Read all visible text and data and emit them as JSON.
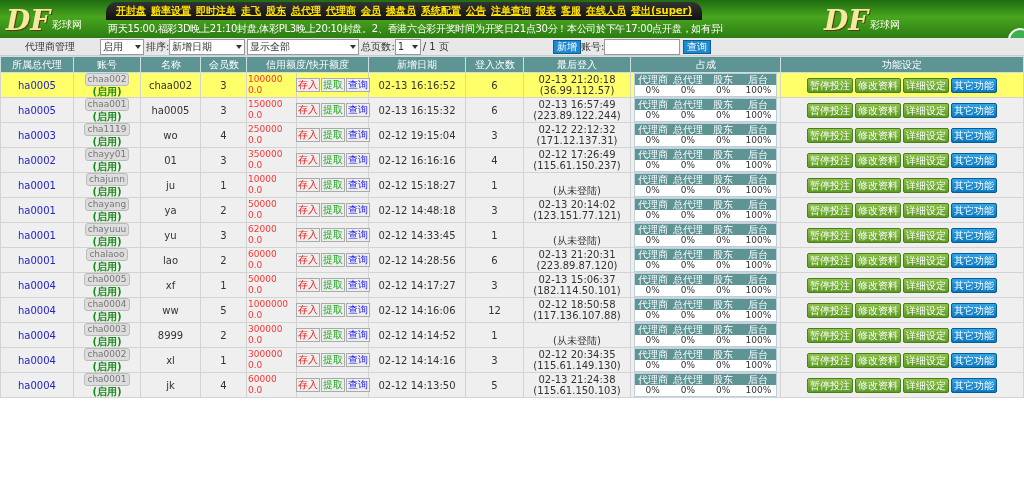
{
  "header": {
    "logos": [
      {
        "mark": "DF",
        "sub": "彩球网"
      },
      {
        "mark": "DF",
        "sub": "彩球网"
      }
    ],
    "menu": [
      "开封盘",
      "赔率设置",
      "即时注单",
      "走飞",
      "股东",
      "总代理",
      "代理商",
      "会员",
      "操盘员",
      "系统配置",
      "公告",
      "注单查询",
      "报表",
      "客服",
      "在线人员",
      "登出(super)"
    ],
    "marquee": "两天15:00,福彩3D晚上21:10封盘,体彩PL3晚上20:10封盘。2、香港六合彩开奖时间为开奖日21点30分！本公司於下午17:00点开盘，如有异i"
  },
  "toolbar": {
    "title": "代理商管理",
    "status_select": "启用",
    "sort_label": "排序:",
    "sort_select": "新增日期",
    "filter_select": "显示全部",
    "pages_label": "总页数:",
    "page_select": "1",
    "pages_total": "/ 1 页",
    "add_button": "新增",
    "account_label": "账号:",
    "search_button": "查询"
  },
  "table": {
    "columns": [
      "所属总代理",
      "账号",
      "名称",
      "会员数",
      "信用额度/快开额度",
      "新增日期",
      "登入次数",
      "最后登入",
      "占成",
      "功能设定"
    ],
    "rows": [
      {
        "selected": true,
        "agent": "ha0005",
        "account": "chaa002",
        "status": "(启用)",
        "name": "chaa002",
        "members": "3",
        "credit": "100000",
        "quick": "0.0",
        "credit_buttons": [
          {
            "label": "存入",
            "kind": "deposit"
          },
          {
            "label": "提取",
            "kind": "withdraw"
          },
          {
            "label": "查询",
            "kind": "query"
          }
        ],
        "added": "02-13 16:16:52",
        "logins": "6",
        "last_login": [
          "02-13 21:20:18",
          "(36.99.112.57)"
        ],
        "shares": [
          {
            "label": "代理商",
            "value": "0%"
          },
          {
            "label": "总代理",
            "value": "0%"
          },
          {
            "label": "股东",
            "value": "0%"
          },
          {
            "label": "后台",
            "value": "100%"
          }
        ],
        "actions": [
          {
            "label": "暂停投注",
            "kind": "green"
          },
          {
            "label": "修改资料",
            "kind": "green"
          },
          {
            "label": "详细设定",
            "kind": "green"
          },
          {
            "label": "其它功能",
            "kind": "blue"
          }
        ]
      },
      {
        "selected": false,
        "agent": "ha0005",
        "account": "chaa001",
        "status": "(启用)",
        "name": "ha0005",
        "members": "3",
        "credit": "150000",
        "quick": "0.0",
        "credit_buttons": [
          {
            "label": "存入",
            "kind": "deposit"
          },
          {
            "label": "提取",
            "kind": "withdraw"
          },
          {
            "label": "查询",
            "kind": "query"
          }
        ],
        "added": "02-13 16:15:32",
        "logins": "6",
        "last_login": [
          "02-13 16:57:49",
          "(223.89.122.244)"
        ],
        "shares": [
          {
            "label": "代理商",
            "value": "0%"
          },
          {
            "label": "总代理",
            "value": "0%"
          },
          {
            "label": "股东",
            "value": "0%"
          },
          {
            "label": "后台",
            "value": "100%"
          }
        ],
        "actions": [
          {
            "label": "暂停投注",
            "kind": "green"
          },
          {
            "label": "修改资料",
            "kind": "green"
          },
          {
            "label": "详细设定",
            "kind": "green"
          },
          {
            "label": "其它功能",
            "kind": "blue"
          }
        ]
      },
      {
        "selected": false,
        "agent": "ha0003",
        "account": "cha1119",
        "status": "(启用)",
        "name": "wo",
        "members": "4",
        "credit": "250000",
        "quick": "0.0",
        "credit_buttons": [
          {
            "label": "存入",
            "kind": "deposit"
          },
          {
            "label": "提取",
            "kind": "withdraw"
          },
          {
            "label": "查询",
            "kind": "query"
          }
        ],
        "added": "02-12 19:15:04",
        "logins": "3",
        "last_login": [
          "02-12 22:12:32",
          "(171.12.137.31)"
        ],
        "shares": [
          {
            "label": "代理商",
            "value": "0%"
          },
          {
            "label": "总代理",
            "value": "0%"
          },
          {
            "label": "股东",
            "value": "0%"
          },
          {
            "label": "后台",
            "value": "100%"
          }
        ],
        "actions": [
          {
            "label": "暂停投注",
            "kind": "green"
          },
          {
            "label": "修改资料",
            "kind": "green"
          },
          {
            "label": "详细设定",
            "kind": "green"
          },
          {
            "label": "其它功能",
            "kind": "blue"
          }
        ]
      },
      {
        "selected": false,
        "agent": "ha0002",
        "account": "chayy01",
        "status": "(启用)",
        "name": "01",
        "members": "3",
        "credit": "350000",
        "quick": "0.0",
        "credit_buttons": [
          {
            "label": "存入",
            "kind": "deposit"
          },
          {
            "label": "提取",
            "kind": "withdraw"
          },
          {
            "label": "查询",
            "kind": "query"
          }
        ],
        "added": "02-12 16:16:16",
        "logins": "4",
        "last_login": [
          "02-12 17:26:49",
          "(115.61.150.237)"
        ],
        "shares": [
          {
            "label": "代理商",
            "value": "0%"
          },
          {
            "label": "总代理",
            "value": "0%"
          },
          {
            "label": "股东",
            "value": "0%"
          },
          {
            "label": "后台",
            "value": "100%"
          }
        ],
        "actions": [
          {
            "label": "暂停投注",
            "kind": "green"
          },
          {
            "label": "修改资料",
            "kind": "green"
          },
          {
            "label": "详细设定",
            "kind": "green"
          },
          {
            "label": "其它功能",
            "kind": "blue"
          }
        ]
      },
      {
        "selected": false,
        "agent": "ha0001",
        "account": "chajunn",
        "status": "(启用)",
        "name": "ju",
        "members": "1",
        "credit": "10000",
        "quick": "0.0",
        "credit_buttons": [
          {
            "label": "存入",
            "kind": "deposit"
          },
          {
            "label": "提取",
            "kind": "withdraw"
          },
          {
            "label": "查询",
            "kind": "query"
          }
        ],
        "added": "02-12 15:18:27",
        "logins": "1",
        "last_login": [
          "(从未登陆)"
        ],
        "shares": [
          {
            "label": "代理商",
            "value": "0%"
          },
          {
            "label": "总代理",
            "value": "0%"
          },
          {
            "label": "股东",
            "value": "0%"
          },
          {
            "label": "后台",
            "value": "100%"
          }
        ],
        "actions": [
          {
            "label": "暂停投注",
            "kind": "green"
          },
          {
            "label": "修改资料",
            "kind": "green"
          },
          {
            "label": "详细设定",
            "kind": "green"
          },
          {
            "label": "其它功能",
            "kind": "blue"
          }
        ]
      },
      {
        "selected": false,
        "agent": "ha0001",
        "account": "chayang",
        "status": "(启用)",
        "name": "ya",
        "members": "2",
        "credit": "50000",
        "quick": "0.0",
        "credit_buttons": [
          {
            "label": "存入",
            "kind": "deposit"
          },
          {
            "label": "提取",
            "kind": "withdraw"
          },
          {
            "label": "查询",
            "kind": "query"
          }
        ],
        "added": "02-12 14:48:18",
        "logins": "3",
        "last_login": [
          "02-13 20:14:02",
          "(123.151.77.121)"
        ],
        "shares": [
          {
            "label": "代理商",
            "value": "0%"
          },
          {
            "label": "总代理",
            "value": "0%"
          },
          {
            "label": "股东",
            "value": "0%"
          },
          {
            "label": "后台",
            "value": "100%"
          }
        ],
        "actions": [
          {
            "label": "暂停投注",
            "kind": "green"
          },
          {
            "label": "修改资料",
            "kind": "green"
          },
          {
            "label": "详细设定",
            "kind": "green"
          },
          {
            "label": "其它功能",
            "kind": "blue"
          }
        ]
      },
      {
        "selected": false,
        "agent": "ha0001",
        "account": "chayuuu",
        "status": "(启用)",
        "name": "yu",
        "members": "3",
        "credit": "62000",
        "quick": "0.0",
        "credit_buttons": [
          {
            "label": "存入",
            "kind": "deposit"
          },
          {
            "label": "提取",
            "kind": "withdraw"
          },
          {
            "label": "查询",
            "kind": "query"
          }
        ],
        "added": "02-12 14:33:45",
        "logins": "1",
        "last_login": [
          "(从未登陆)"
        ],
        "shares": [
          {
            "label": "代理商",
            "value": "0%"
          },
          {
            "label": "总代理",
            "value": "0%"
          },
          {
            "label": "股东",
            "value": "0%"
          },
          {
            "label": "后台",
            "value": "100%"
          }
        ],
        "actions": [
          {
            "label": "暂停投注",
            "kind": "green"
          },
          {
            "label": "修改资料",
            "kind": "green"
          },
          {
            "label": "详细设定",
            "kind": "green"
          },
          {
            "label": "其它功能",
            "kind": "blue"
          }
        ]
      },
      {
        "selected": false,
        "agent": "ha0001",
        "account": "chalaoo",
        "status": "(启用)",
        "name": "lao",
        "members": "2",
        "credit": "60000",
        "quick": "0.0",
        "credit_buttons": [
          {
            "label": "存入",
            "kind": "deposit"
          },
          {
            "label": "提取",
            "kind": "withdraw"
          },
          {
            "label": "查询",
            "kind": "query"
          }
        ],
        "added": "02-12 14:28:56",
        "logins": "6",
        "last_login": [
          "02-13 21:20:31",
          "(223.89.87.120)"
        ],
        "shares": [
          {
            "label": "代理商",
            "value": "0%"
          },
          {
            "label": "总代理",
            "value": "0%"
          },
          {
            "label": "股东",
            "value": "0%"
          },
          {
            "label": "后台",
            "value": "100%"
          }
        ],
        "actions": [
          {
            "label": "暂停投注",
            "kind": "green"
          },
          {
            "label": "修改资料",
            "kind": "green"
          },
          {
            "label": "详细设定",
            "kind": "green"
          },
          {
            "label": "其它功能",
            "kind": "blue"
          }
        ]
      },
      {
        "selected": false,
        "agent": "ha0004",
        "account": "cha0005",
        "status": "(启用)",
        "name": "xf",
        "members": "1",
        "credit": "50000",
        "quick": "0.0",
        "credit_buttons": [
          {
            "label": "存入",
            "kind": "deposit"
          },
          {
            "label": "提取",
            "kind": "withdraw"
          },
          {
            "label": "查询",
            "kind": "query"
          }
        ],
        "added": "02-12 14:17:27",
        "logins": "3",
        "last_login": [
          "02-13 15:06:37",
          "(182.114.50.101)"
        ],
        "shares": [
          {
            "label": "代理商",
            "value": "0%"
          },
          {
            "label": "总代理",
            "value": "0%"
          },
          {
            "label": "股东",
            "value": "0%"
          },
          {
            "label": "后台",
            "value": "100%"
          }
        ],
        "actions": [
          {
            "label": "暂停投注",
            "kind": "green"
          },
          {
            "label": "修改资料",
            "kind": "green"
          },
          {
            "label": "详细设定",
            "kind": "green"
          },
          {
            "label": "其它功能",
            "kind": "blue"
          }
        ]
      },
      {
        "selected": false,
        "agent": "ha0004",
        "account": "cha0004",
        "status": "(启用)",
        "name": "ww",
        "members": "5",
        "credit": "1000000",
        "quick": "0.0",
        "credit_buttons": [
          {
            "label": "存入",
            "kind": "deposit"
          },
          {
            "label": "提取",
            "kind": "withdraw"
          },
          {
            "label": "查询",
            "kind": "query"
          }
        ],
        "added": "02-12 14:16:06",
        "logins": "12",
        "last_login": [
          "02-12 18:50:58",
          "(117.136.107.88)"
        ],
        "shares": [
          {
            "label": "代理商",
            "value": "0%"
          },
          {
            "label": "总代理",
            "value": "0%"
          },
          {
            "label": "股东",
            "value": "0%"
          },
          {
            "label": "后台",
            "value": "100%"
          }
        ],
        "actions": [
          {
            "label": "暂停投注",
            "kind": "green"
          },
          {
            "label": "修改资料",
            "kind": "green"
          },
          {
            "label": "详细设定",
            "kind": "green"
          },
          {
            "label": "其它功能",
            "kind": "blue"
          }
        ]
      },
      {
        "selected": false,
        "agent": "ha0004",
        "account": "cha0003",
        "status": "(启用)",
        "name": "8999",
        "members": "2",
        "credit": "300000",
        "quick": "0.0",
        "credit_buttons": [
          {
            "label": "存入",
            "kind": "deposit"
          },
          {
            "label": "提取",
            "kind": "withdraw"
          },
          {
            "label": "查询",
            "kind": "query"
          }
        ],
        "added": "02-12 14:14:52",
        "logins": "1",
        "last_login": [
          "(从未登陆)"
        ],
        "shares": [
          {
            "label": "代理商",
            "value": "0%"
          },
          {
            "label": "总代理",
            "value": "0%"
          },
          {
            "label": "股东",
            "value": "0%"
          },
          {
            "label": "后台",
            "value": "100%"
          }
        ],
        "actions": [
          {
            "label": "暂停投注",
            "kind": "green"
          },
          {
            "label": "修改资料",
            "kind": "green"
          },
          {
            "label": "详细设定",
            "kind": "green"
          },
          {
            "label": "其它功能",
            "kind": "blue"
          }
        ]
      },
      {
        "selected": false,
        "agent": "ha0004",
        "account": "cha0002",
        "status": "(启用)",
        "name": "xl",
        "members": "1",
        "credit": "300000",
        "quick": "0.0",
        "credit_buttons": [
          {
            "label": "存入",
            "kind": "deposit"
          },
          {
            "label": "提取",
            "kind": "withdraw"
          },
          {
            "label": "查询",
            "kind": "query"
          }
        ],
        "added": "02-12 14:14:16",
        "logins": "3",
        "last_login": [
          "02-12 20:34:35",
          "(115.61.149.130)"
        ],
        "shares": [
          {
            "label": "代理商",
            "value": "0%"
          },
          {
            "label": "总代理",
            "value": "0%"
          },
          {
            "label": "股东",
            "value": "0%"
          },
          {
            "label": "后台",
            "value": "100%"
          }
        ],
        "actions": [
          {
            "label": "暂停投注",
            "kind": "green"
          },
          {
            "label": "修改资料",
            "kind": "green"
          },
          {
            "label": "详细设定",
            "kind": "green"
          },
          {
            "label": "其它功能",
            "kind": "blue"
          }
        ]
      },
      {
        "selected": false,
        "agent": "ha0004",
        "account": "cha0001",
        "status": "(启用)",
        "name": "jk",
        "members": "4",
        "credit": "60000",
        "quick": "0.0",
        "credit_buttons": [
          {
            "label": "存入",
            "kind": "deposit"
          },
          {
            "label": "提取",
            "kind": "withdraw"
          },
          {
            "label": "查询",
            "kind": "query"
          }
        ],
        "added": "02-12 14:13:50",
        "logins": "5",
        "last_login": [
          "02-13 21:24:38",
          "(115.61.150.103)"
        ],
        "shares": [
          {
            "label": "代理商",
            "value": "0%"
          },
          {
            "label": "总代理",
            "value": "0%"
          },
          {
            "label": "股东",
            "value": "0%"
          },
          {
            "label": "后台",
            "value": "100%"
          }
        ],
        "actions": [
          {
            "label": "暂停投注",
            "kind": "green"
          },
          {
            "label": "修改资料",
            "kind": "green"
          },
          {
            "label": "详细设定",
            "kind": "green"
          },
          {
            "label": "其它功能",
            "kind": "blue"
          }
        ]
      }
    ]
  }
}
